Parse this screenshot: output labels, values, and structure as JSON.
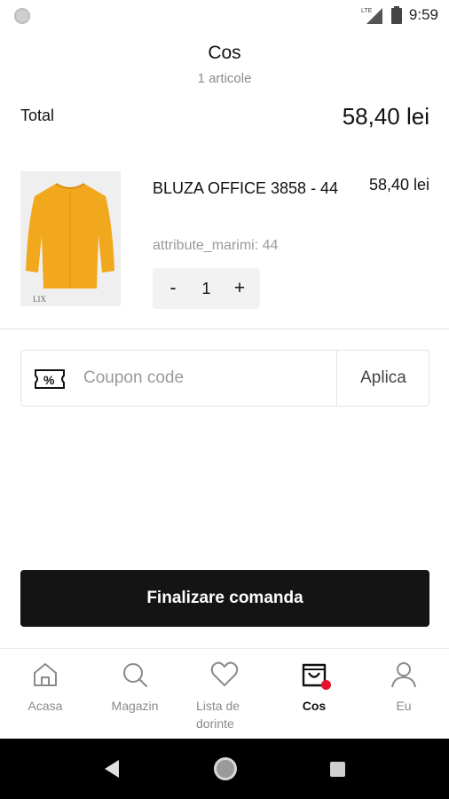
{
  "status_bar": {
    "time": "9:59",
    "network": "LTE"
  },
  "header": {
    "title": "Cos",
    "item_count": "1 articole"
  },
  "summary": {
    "total_label": "Total",
    "total_value": "58,40 lei"
  },
  "cart_items": [
    {
      "name": "BLUZA OFFICE 3858 - 44",
      "price": "58,40 lei",
      "attribute": "attribute_marimi: 44",
      "quantity": "1",
      "decrement_label": "-",
      "increment_label": "+",
      "image_watermark": "LIX",
      "image_color": "#f2a81d"
    }
  ],
  "coupon": {
    "placeholder": "Coupon code",
    "apply_label": "Aplica",
    "icon": "coupon-ticket-icon"
  },
  "checkout": {
    "label": "Finalizare comanda"
  },
  "bottom_nav": {
    "items": [
      {
        "label": "Acasa",
        "icon": "home-icon",
        "active": false
      },
      {
        "label": "Magazin",
        "icon": "search-icon",
        "active": false
      },
      {
        "label": "Lista de dorinte",
        "icon": "heart-icon",
        "active": false
      },
      {
        "label": "Cos",
        "icon": "shopping-bag-icon",
        "active": true
      },
      {
        "label": "Eu",
        "icon": "user-icon",
        "active": false
      }
    ]
  },
  "colors": {
    "accent": "#141414",
    "badge": "#e8102e",
    "muted_text": "#9a9a9a"
  }
}
